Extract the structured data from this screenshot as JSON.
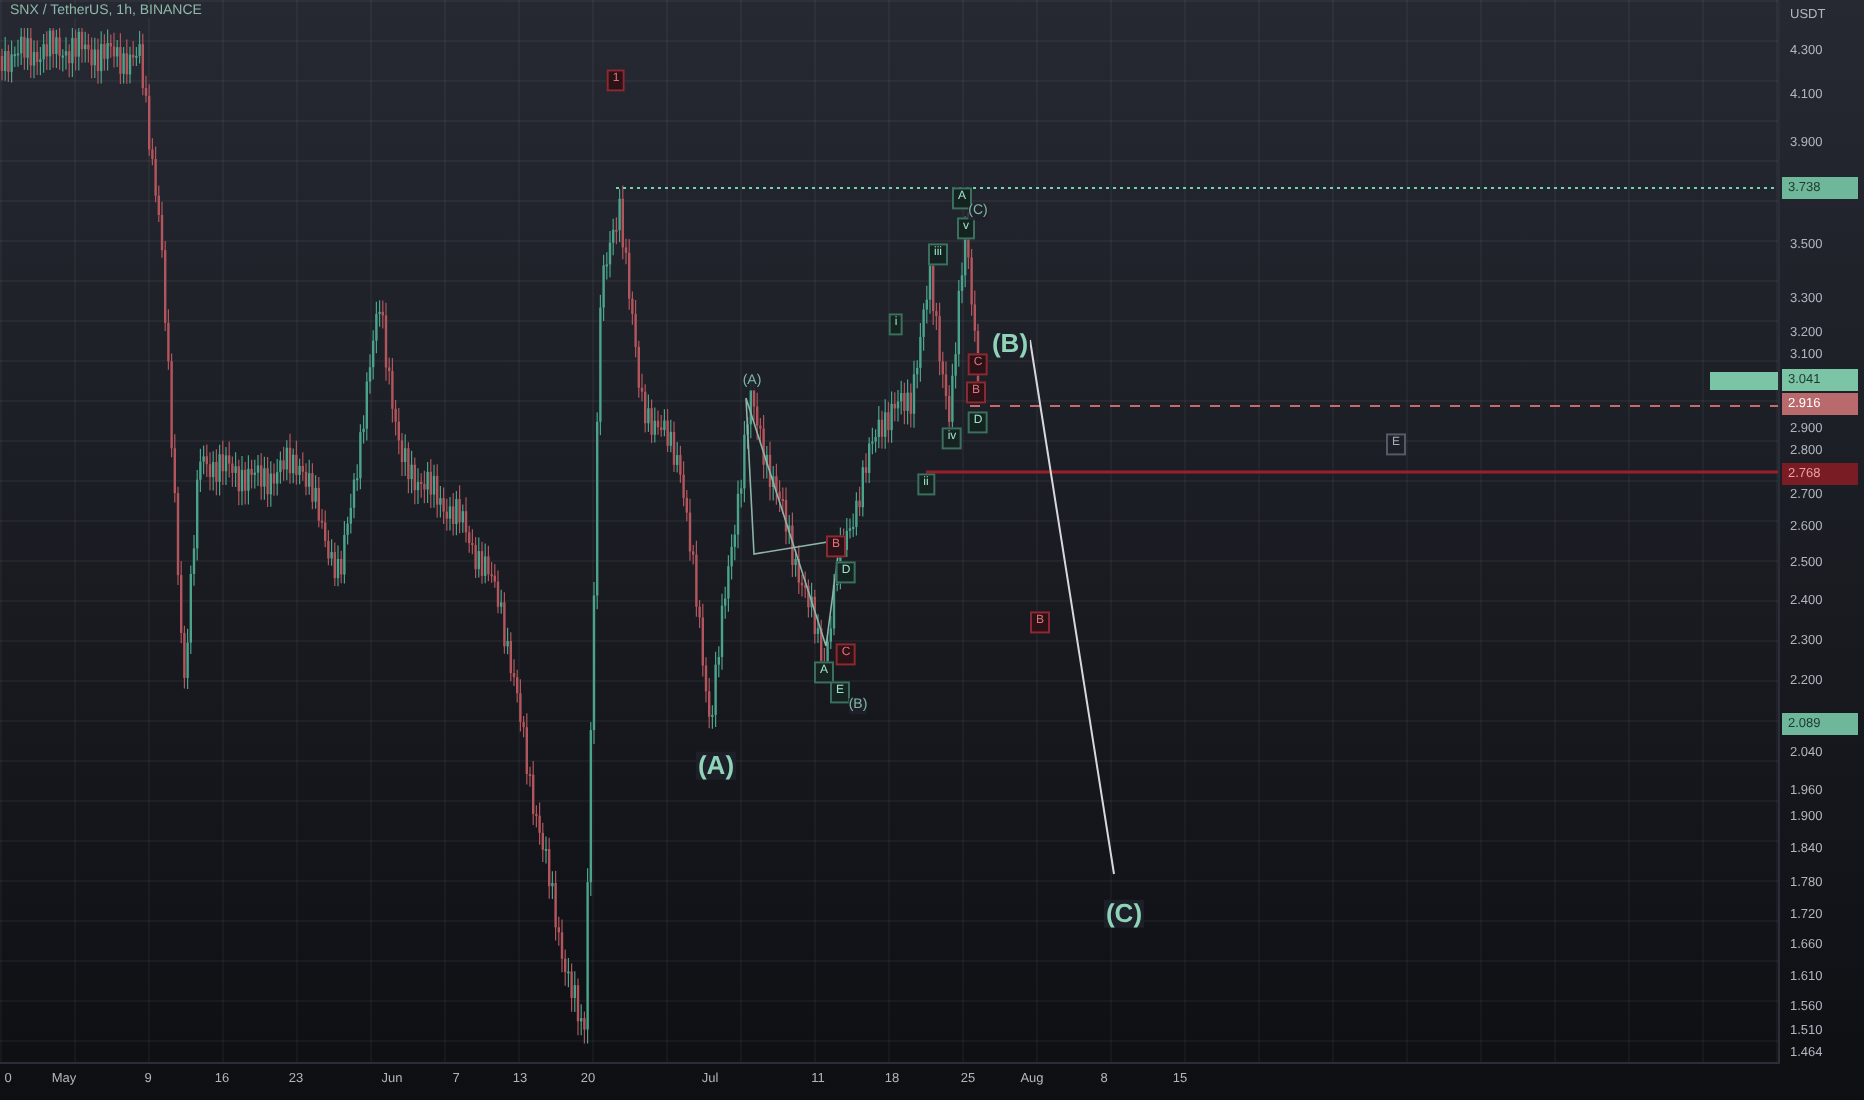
{
  "header": {
    "symbol": "SNX / TetherUS, 1h, BINANCE"
  },
  "price_axis": {
    "unit": "USDT",
    "ticks": [
      "4.300",
      "4.100",
      "3.900",
      "3.500",
      "3.300",
      "3.200",
      "3.100",
      "2.900",
      "2.800",
      "2.700",
      "2.600",
      "2.500",
      "2.400",
      "2.300",
      "2.200",
      "2.040",
      "1.960",
      "1.900",
      "1.840",
      "1.780",
      "1.720",
      "1.660",
      "1.610",
      "1.560",
      "1.510",
      "1.464"
    ]
  },
  "price_tags": [
    {
      "text": "3.738",
      "kind": "target"
    },
    {
      "text": "3.041",
      "kind": "last"
    },
    {
      "text": "2.916",
      "kind": "dashed"
    },
    {
      "text": "2.768",
      "kind": "level"
    },
    {
      "text": "2.089",
      "kind": "target"
    }
  ],
  "time_axis": [
    "0",
    "May",
    "9",
    "16",
    "23",
    "Jun",
    "7",
    "13",
    "20",
    "Jul",
    "11",
    "18",
    "25",
    "Aug",
    "8",
    "15"
  ],
  "wave_labels": [
    {
      "text": "(A)",
      "kind": "large"
    },
    {
      "text": "(B)",
      "kind": "large"
    },
    {
      "text": "(C)",
      "kind": "large"
    },
    {
      "text": "(A)",
      "kind": "plain"
    },
    {
      "text": "A",
      "kind": "boxed"
    },
    {
      "text": "B",
      "kind": "boxed-red"
    },
    {
      "text": "D",
      "kind": "boxed"
    },
    {
      "text": "C",
      "kind": "boxed-red"
    },
    {
      "text": "E",
      "kind": "boxed"
    },
    {
      "text": "(B)",
      "kind": "plain"
    },
    {
      "text": "i",
      "kind": "boxed"
    },
    {
      "text": "ii",
      "kind": "boxed"
    },
    {
      "text": "iii",
      "kind": "boxed"
    },
    {
      "text": "iv",
      "kind": "boxed"
    },
    {
      "text": "v",
      "kind": "boxed"
    },
    {
      "text": "A",
      "kind": "boxed"
    },
    {
      "text": "(C)",
      "kind": "plain"
    },
    {
      "text": "C",
      "kind": "boxed-red"
    },
    {
      "text": "B",
      "kind": "boxed-red"
    },
    {
      "text": "D",
      "kind": "boxed"
    },
    {
      "text": "B",
      "kind": "boxed-red"
    },
    {
      "text": "E",
      "kind": "boxed-grey"
    },
    {
      "text": "1",
      "kind": "boxed-red"
    }
  ]
}
